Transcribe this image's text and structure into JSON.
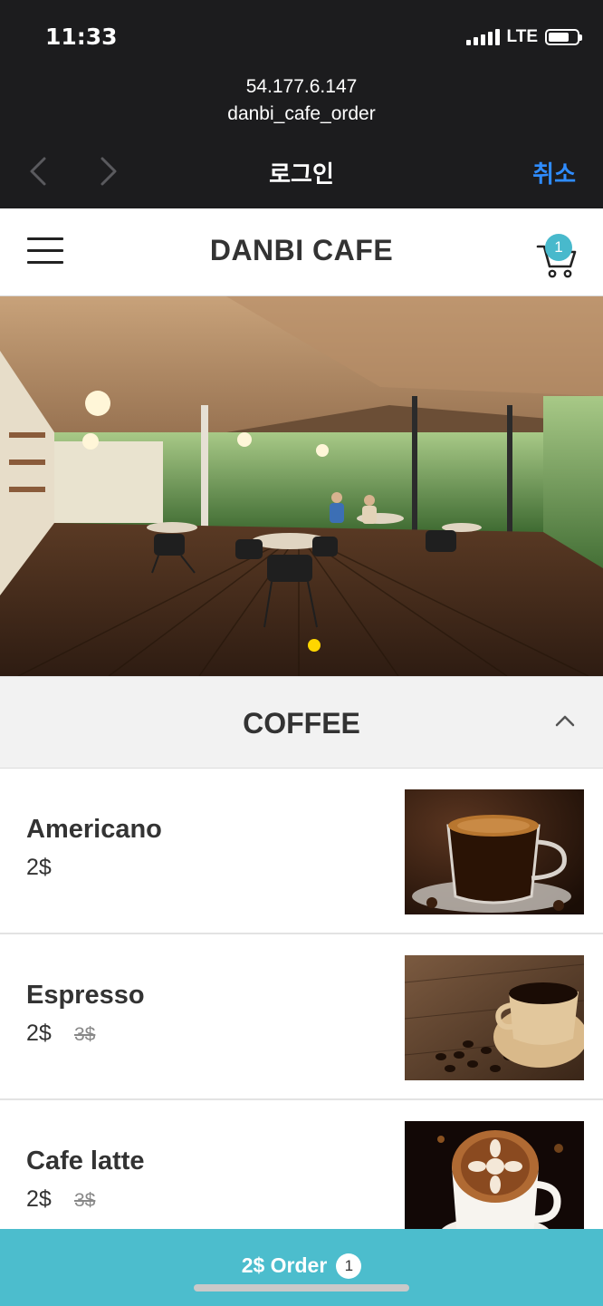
{
  "status_bar": {
    "time": "11:33",
    "network": "LTE"
  },
  "browser": {
    "host": "54.177.6.147",
    "path": "danbi_cafe_order",
    "title": "로그인",
    "cancel_label": "취소"
  },
  "header": {
    "brand": "DANBI CAFE",
    "cart_count": "1"
  },
  "hero": {
    "slide_count": 1,
    "active_slide": 1
  },
  "category": {
    "title": "COFFEE",
    "expanded": true
  },
  "menu": [
    {
      "name": "Americano",
      "price": "2$",
      "old_price": ""
    },
    {
      "name": "Espresso",
      "price": "2$",
      "old_price": "3$"
    },
    {
      "name": "Cafe latte",
      "price": "2$",
      "old_price": "3$"
    }
  ],
  "order_bar": {
    "label": "2$ Order",
    "count": "1"
  },
  "colors": {
    "accent": "#4cbdcd",
    "badge": "#48b9cc",
    "link": "#2f8cff",
    "dot": "#ffd600",
    "dark_bar": "#1c1c1e"
  }
}
